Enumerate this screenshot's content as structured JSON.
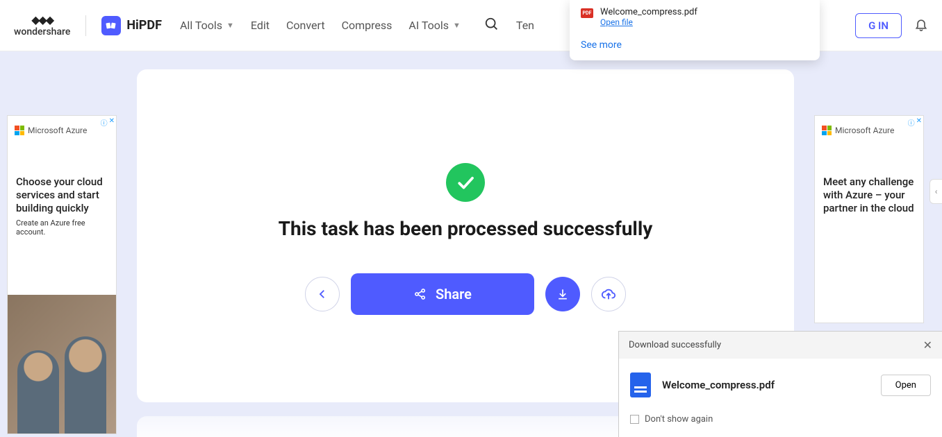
{
  "header": {
    "brand_parent": "wondershare",
    "brand_product": "HiPDF",
    "nav": {
      "all_tools": "All Tools",
      "edit": "Edit",
      "convert": "Convert",
      "compress": "Compress",
      "ai_tools": "AI Tools",
      "templates_partial": "Ten"
    },
    "signin_partial": "G IN"
  },
  "browser_download": {
    "filename": "Welcome_compress.pdf",
    "open_label": "Open file",
    "see_more": "See more",
    "badge": "PDF"
  },
  "main": {
    "title": "This task has been processed successfully",
    "share_label": "Share"
  },
  "ad_left": {
    "brand": "Microsoft Azure",
    "headline": "Choose your cloud services and start building quickly",
    "sub": "Create an Azure free account."
  },
  "ad_right": {
    "brand": "Microsoft Azure",
    "headline": "Meet any challenge with Azure – your partner in the cloud"
  },
  "download_panel": {
    "title": "Download successfully",
    "filename": "Welcome_compress.pdf",
    "open": "Open",
    "dont_show": "Don't show again"
  }
}
